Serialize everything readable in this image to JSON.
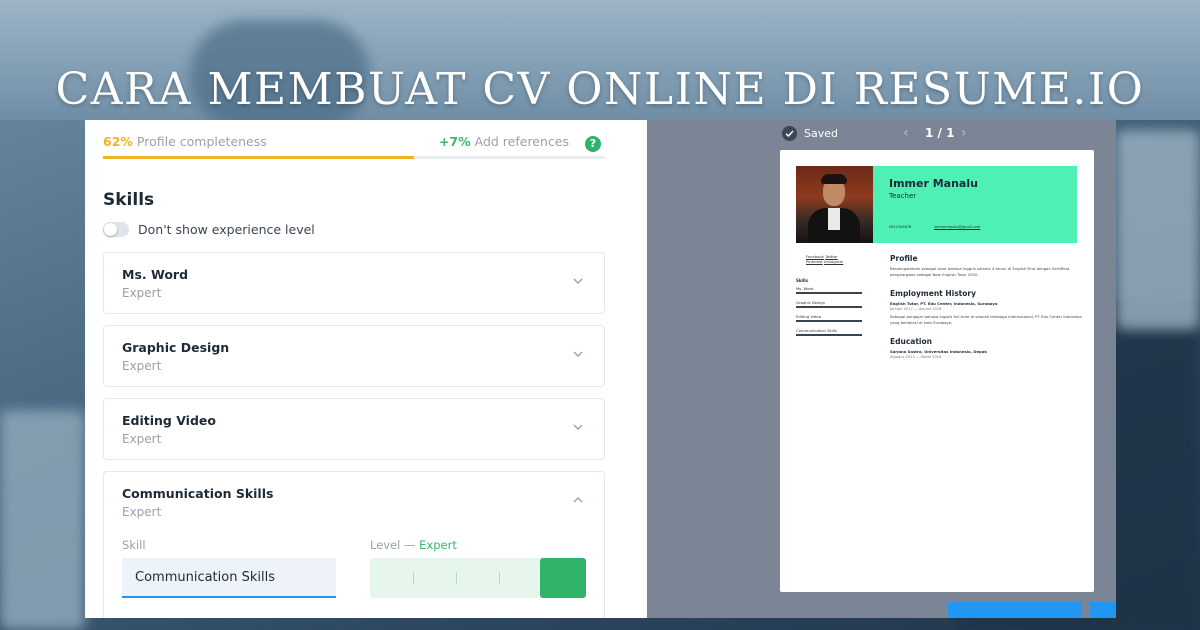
{
  "headline": "CARA MEMBUAT CV ONLINE DI RESUME.IO",
  "progress": {
    "percent_label": "62%",
    "percent_value": 62,
    "label": "Profile completeness",
    "boost_label": "+7%",
    "boost_text": "Add references",
    "help_glyph": "?"
  },
  "skills_section": {
    "title": "Skills",
    "toggle_label": "Don't show experience level",
    "toggle_on": false,
    "items": [
      {
        "name": "Ms. Word",
        "level": "Expert",
        "expanded": false
      },
      {
        "name": "Graphic Design",
        "level": "Expert",
        "expanded": false
      },
      {
        "name": "Editing Video",
        "level": "Expert",
        "expanded": false
      },
      {
        "name": "Communication Skills",
        "level": "Expert",
        "expanded": true
      }
    ],
    "editor": {
      "skill_label": "Skill",
      "skill_value": "Communication Skills",
      "level_label": "Level — ",
      "level_value": "Expert"
    }
  },
  "preview": {
    "saved_label": "Saved",
    "page_indicator": "1 / 1",
    "resume": {
      "name": "Immer Manalu",
      "title": "Teacher",
      "phone": "0812345678",
      "email": "immermanalu@gmail.com",
      "links": [
        "Facebook",
        "Twitter",
        "Pinterest",
        "Instagram"
      ],
      "skills_heading": "Skills",
      "skills": [
        "Ms. Word",
        "Graphic Design",
        "Editing Video",
        "Communication Skills"
      ],
      "profile_heading": "Profile",
      "profile_text": "Berpengalaman sebagai tutor bahasa inggris selama 4 tahun di English First dengan Sertifikat penghargaan sebagai Best English Tutor 2020.",
      "employment_heading": "Employment History",
      "job_title": "English Tutor, PT. Edu Center, Indonesia, Surabaya",
      "job_dates": "Januari 2017 — Januari 2018",
      "job_desc": "Sebagai pengajar bahasa inggris full-time di sebuah lembaga internasional, PT Edu Center Indonesia yang berlokasi di kota Surabaya.",
      "education_heading": "Education",
      "school": "Sarjana Sastra, Universitas Indonesia, Depok",
      "school_dates": "Agustus 2013 — Maret 2016"
    }
  },
  "colors": {
    "accent_yellow": "#f0b323",
    "accent_green": "#2fb36b",
    "resume_header": "#4ef0b4",
    "primary_blue": "#2196f3",
    "preview_bg": "#7b8595"
  }
}
